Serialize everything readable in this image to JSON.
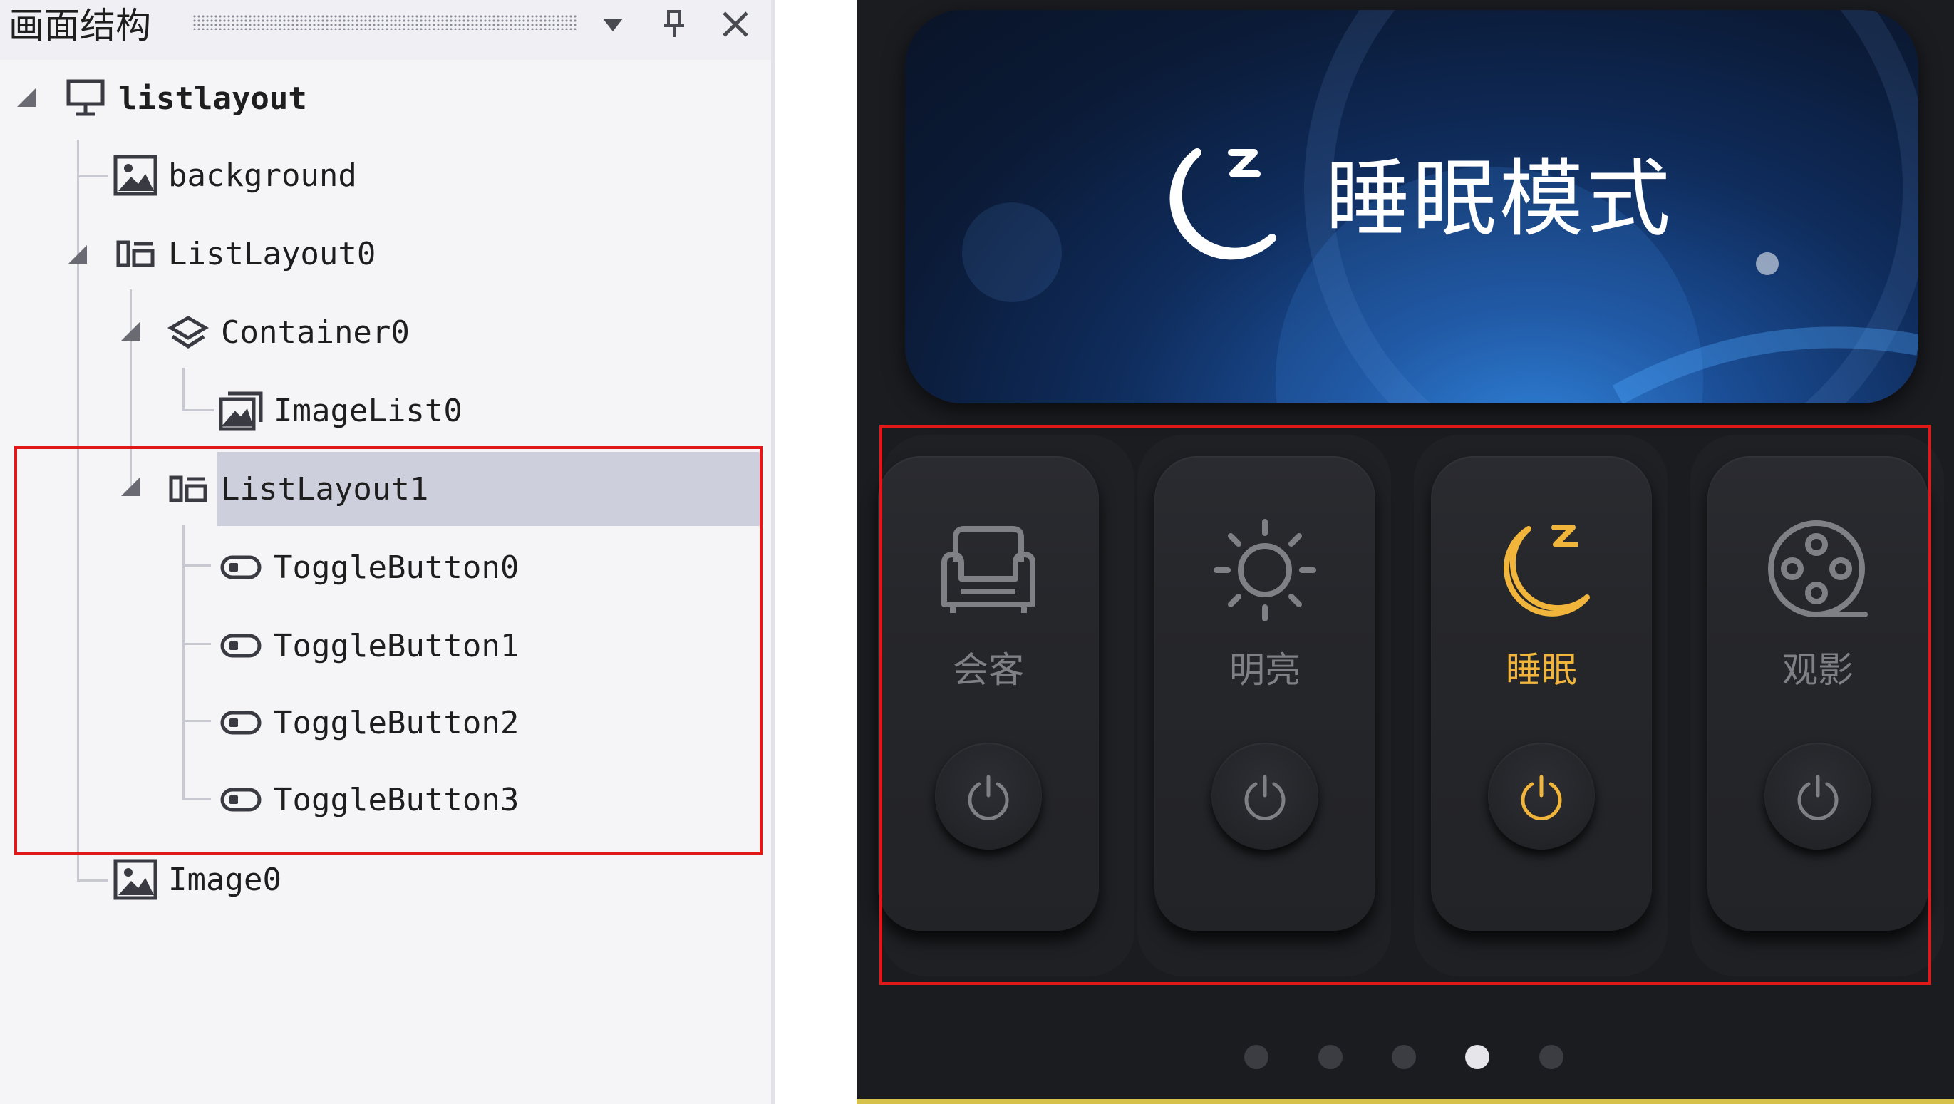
{
  "panel": {
    "title": "画面结构",
    "dropdown_icon": "triangle-down-icon",
    "pin_icon": "pin-icon",
    "close_icon": "close-icon"
  },
  "tree": [
    {
      "label": "listlayout",
      "icon": "monitor-icon",
      "expanded": true
    },
    {
      "label": "background",
      "icon": "image-icon"
    },
    {
      "label": "ListLayout0",
      "icon": "list-layout-icon",
      "expanded": true
    },
    {
      "label": "Container0",
      "icon": "layers-icon",
      "expanded": true
    },
    {
      "label": "ImageList0",
      "icon": "image-list-icon"
    },
    {
      "label": "ListLayout1",
      "icon": "list-layout-icon",
      "expanded": true,
      "selected": true
    },
    {
      "label": "ToggleButton0",
      "icon": "toggle-icon"
    },
    {
      "label": "ToggleButton1",
      "icon": "toggle-icon"
    },
    {
      "label": "ToggleButton2",
      "icon": "toggle-icon"
    },
    {
      "label": "ToggleButton3",
      "icon": "toggle-icon"
    },
    {
      "label": "Image0",
      "icon": "image-icon"
    }
  ],
  "preview": {
    "banner": {
      "title": "睡眠模式",
      "icon": "moon-sleep-icon"
    },
    "cards": [
      {
        "label": "会客",
        "icon": "sofa-icon",
        "active": false
      },
      {
        "label": "明亮",
        "icon": "sun-icon",
        "active": false
      },
      {
        "label": "睡眠",
        "icon": "moon-sleep-icon",
        "active": true
      },
      {
        "label": "观影",
        "icon": "film-reel-icon",
        "active": false
      }
    ],
    "page_indicator": {
      "count": 5,
      "active_index": 3
    }
  },
  "colors": {
    "accent": "#f0b53a",
    "inactive": "#7f8086",
    "highlight_box": "#e01818",
    "selection": "#cdd0dc",
    "preview_bg": "#1b1c20"
  }
}
